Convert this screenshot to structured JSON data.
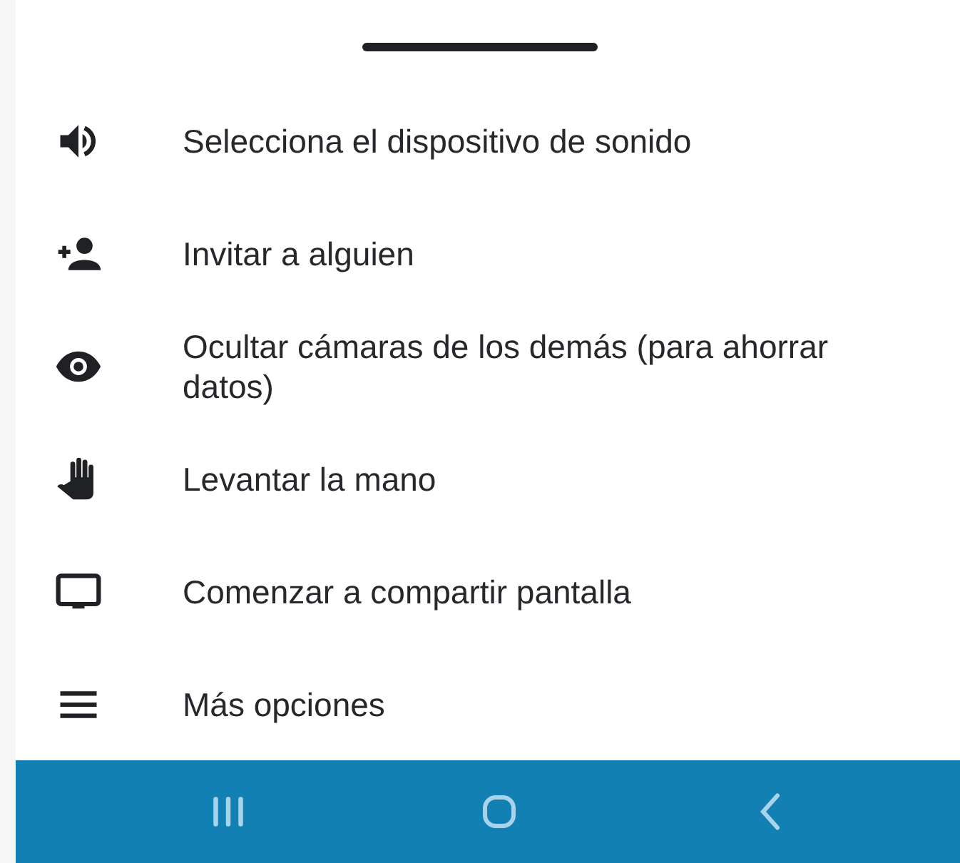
{
  "menu": {
    "items": [
      {
        "kind": "speaker",
        "label": "Selecciona el dispositivo de sonido"
      },
      {
        "kind": "invite",
        "label": "Invitar a alguien"
      },
      {
        "kind": "eye",
        "label": "Ocultar cámaras de los demás (para ahorrar datos)"
      },
      {
        "kind": "hand",
        "label": "Levantar la mano"
      },
      {
        "kind": "screen",
        "label": "Comenzar a compartir pantalla"
      },
      {
        "kind": "menu",
        "label": "Más opciones"
      }
    ]
  },
  "nav_bar": {
    "buttons": [
      {
        "kind": "recents"
      },
      {
        "kind": "home"
      },
      {
        "kind": "back"
      }
    ]
  }
}
